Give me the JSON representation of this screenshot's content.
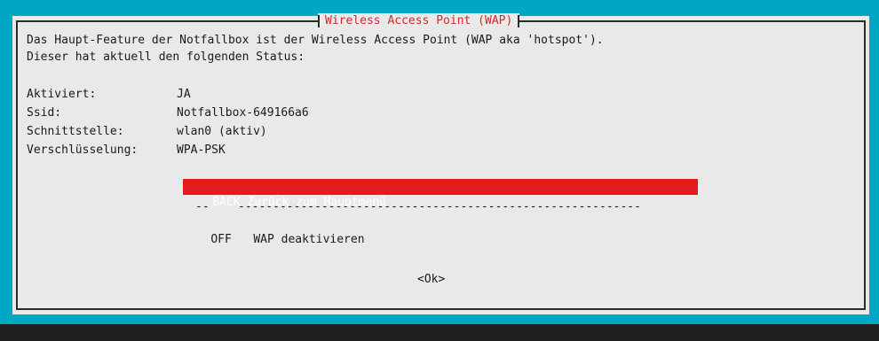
{
  "dialog": {
    "title": "Wireless Access Point (WAP)",
    "intro_line1": "Das Haupt-Feature der Notfallbox ist der Wireless Access Point (WAP aka 'hotspot').",
    "intro_line2": "Dieser hat aktuell den folgenden Status:"
  },
  "status": {
    "activated_label": "Aktiviert:",
    "activated_value": "JA",
    "ssid_label": "Ssid:",
    "ssid_value": "Notfallbox-649166a6",
    "interface_label": "Schnittstelle:",
    "interface_value": "wlan0 (aktiv)",
    "encryption_label": "Verschlüsselung:",
    "encryption_value": "WPA-PSK"
  },
  "menu": {
    "items": [
      {
        "tag": "BACK",
        "label": "Zurück zum Hauptmenü",
        "selected": true
      },
      {
        "tag": "--",
        "label": "----------------------------------------------------------",
        "selected": false
      },
      {
        "tag": "OFF",
        "label": "WAP deaktivieren",
        "selected": false
      }
    ]
  },
  "buttons": {
    "ok_label": "<Ok>"
  },
  "colors": {
    "background": "#00a7c4",
    "dialog": "#e9e9e9",
    "accent_red": "#e21c1c",
    "title_red": "#d22b2b",
    "terminal_bar": "#1f1f1f"
  }
}
